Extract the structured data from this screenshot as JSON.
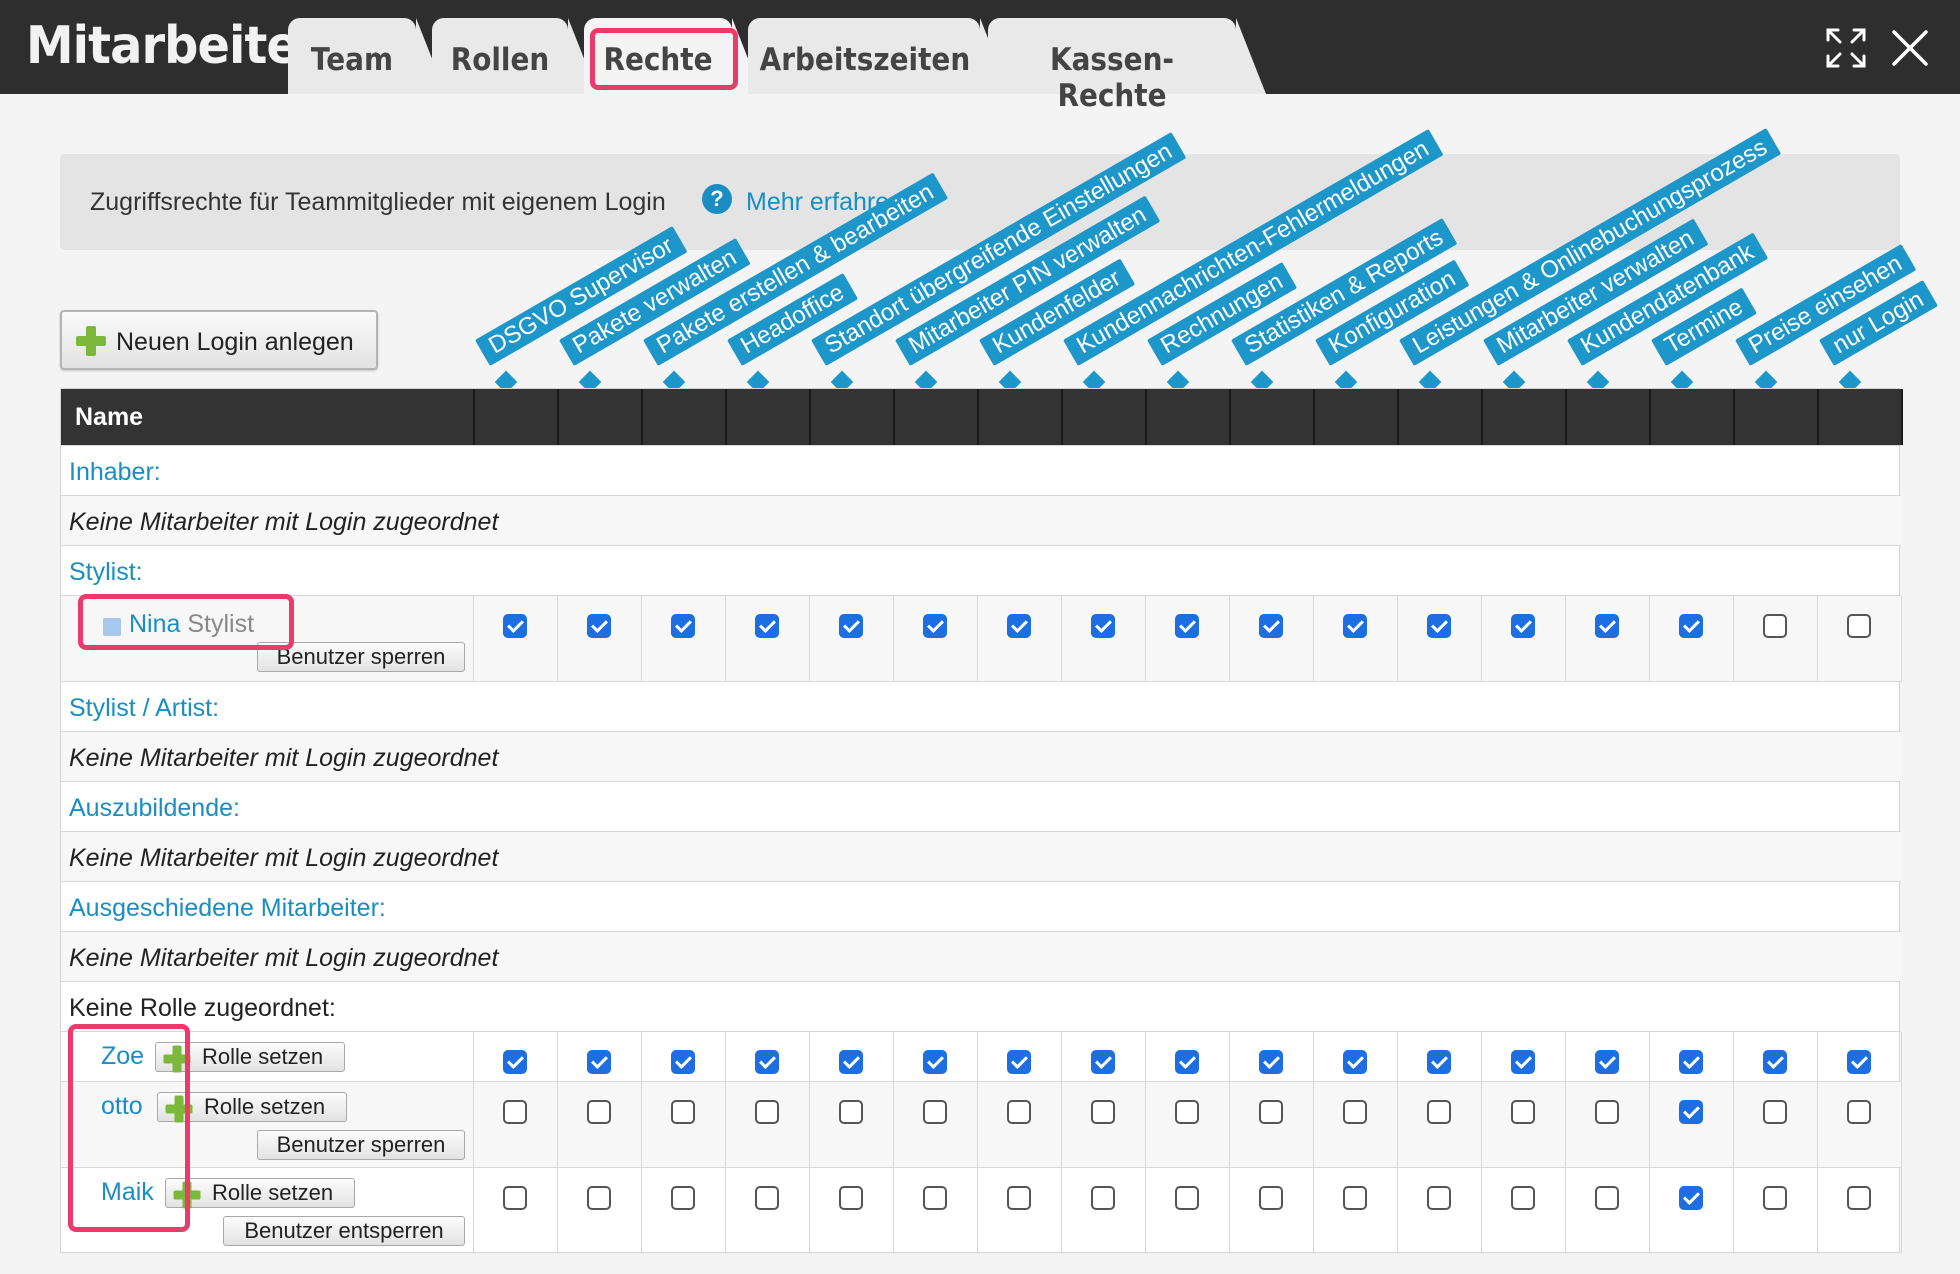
{
  "header": {
    "title": "Mitarbeiter",
    "tabs": [
      {
        "label": "Team"
      },
      {
        "label": "Rollen"
      },
      {
        "label": "Rechte"
      },
      {
        "label": "Arbeitszeiten"
      },
      {
        "label": "Kassen-Rechte"
      }
    ],
    "active_tab": "Rechte",
    "icons": [
      "expand-icon",
      "close-icon"
    ]
  },
  "info": {
    "text": "Zugriffsrechte für Teammitglieder mit eigenem Login",
    "help_icon": "?",
    "link": "Mehr erfahren"
  },
  "new_login_button": "Neuen Login anlegen",
  "columns": [
    "DSGVO Supervisor",
    "Pakete verwalten",
    "Pakete erstellen & bearbeiten",
    "Headoffice",
    "Standort übergreifende Einstellungen",
    "Mitarbeiter PIN verwalten",
    "Kundenfelder",
    "Kundennachrichten-Fehlermeldungen",
    "Rechnungen",
    "Statistiken & Reports",
    "Konfiguration",
    "Leistungen & Onlinebuchungsprozess",
    "Mitarbeiter verwalten",
    "Kundendatenbank",
    "Termine",
    "Preise einsehen",
    "nur Login"
  ],
  "table": {
    "name_header": "Name",
    "empty_text": "Keine Mitarbeiter mit Login zugeordnet",
    "groups": {
      "inhaber": "Inhaber:",
      "stylist": "Stylist:",
      "stylist_artist": "Stylist / Artist:",
      "auszubildende": "Auszubildende:",
      "ausgeschieden": "Ausgeschiedene Mitarbeiter:",
      "keine_rolle": "Keine Rolle zugeordnet:"
    },
    "users": [
      {
        "name": "Nina",
        "role": "Stylist",
        "buttons": [
          "Benutzer sperren"
        ],
        "permissions": [
          true,
          true,
          true,
          true,
          true,
          true,
          true,
          true,
          true,
          true,
          true,
          true,
          true,
          true,
          true,
          false,
          false
        ]
      },
      {
        "name": "Zoe",
        "buttons": [
          "Rolle setzen"
        ],
        "permissions": [
          true,
          true,
          true,
          true,
          true,
          true,
          true,
          true,
          true,
          true,
          true,
          true,
          true,
          true,
          true,
          true,
          true
        ]
      },
      {
        "name": "otto",
        "buttons": [
          "Rolle setzen",
          "Benutzer sperren"
        ],
        "permissions": [
          false,
          false,
          false,
          false,
          false,
          false,
          false,
          false,
          false,
          false,
          false,
          false,
          false,
          false,
          true,
          false,
          false
        ]
      },
      {
        "name": "Maik",
        "buttons": [
          "Rolle setzen",
          "Benutzer entsperren"
        ],
        "permissions": [
          false,
          false,
          false,
          false,
          false,
          false,
          false,
          false,
          false,
          false,
          false,
          false,
          false,
          false,
          true,
          false,
          false
        ]
      }
    ]
  },
  "colors": {
    "header_bg": "#2e2e2e",
    "accent_blue": "#1d96c9",
    "link_blue": "#1a8dc2",
    "checkbox_blue": "#1d6ee0",
    "highlight_pink": "#ec3a6b",
    "plus_green": "#7cb83b"
  }
}
